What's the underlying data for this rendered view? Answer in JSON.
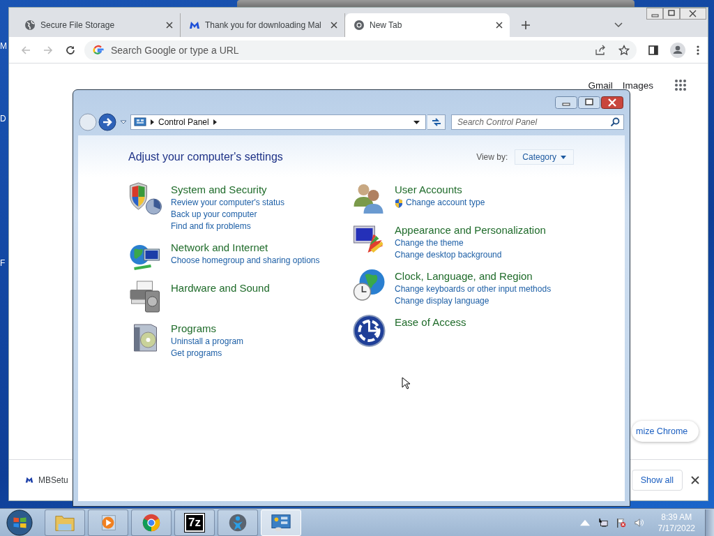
{
  "desktop": {
    "labels": [
      "M",
      "D",
      "F"
    ]
  },
  "browser": {
    "tabs": [
      {
        "title": "Secure File Storage",
        "kind": "globe",
        "selected": false
      },
      {
        "title": "Thank you for downloading Mal",
        "kind": "logo",
        "selected": false
      },
      {
        "title": "New Tab",
        "kind": "chrome",
        "selected": true
      }
    ],
    "omnibox": {
      "placeholder": "Search Google or type a URL"
    },
    "links": [
      "Gmail",
      "Images"
    ],
    "customize_button": "mize Chrome",
    "download": {
      "file": "MBSetu",
      "show_all": "Show all"
    }
  },
  "control_panel": {
    "breadcrumb": "Control Panel",
    "search": {
      "placeholder": "Search Control Panel"
    },
    "heading": "Adjust your computer's settings",
    "view_by": {
      "label": "View by:",
      "value": "Category"
    },
    "columns": [
      [
        {
          "kind": "security",
          "title": "System and Security",
          "links": [
            {
              "text": "Review your computer's status",
              "shield": false
            },
            {
              "text": "Back up your computer",
              "shield": false
            },
            {
              "text": "Find and fix problems",
              "shield": false
            }
          ]
        },
        {
          "kind": "network",
          "title": "Network and Internet",
          "links": [
            {
              "text": "Choose homegroup and sharing options",
              "shield": false
            }
          ]
        },
        {
          "kind": "hardware",
          "title": "Hardware and Sound"
        },
        {
          "kind": "programs",
          "title": "Programs",
          "links": [
            {
              "text": "Uninstall a program",
              "shield": false
            },
            {
              "text": "Get programs",
              "shield": false
            }
          ]
        }
      ],
      [
        {
          "kind": "users",
          "title": "User Accounts",
          "links": [
            {
              "text": "Change account type",
              "shield": true
            }
          ]
        },
        {
          "kind": "appearance",
          "title": "Appearance and Personalization",
          "links": [
            {
              "text": "Change the theme",
              "shield": false
            },
            {
              "text": "Change desktop background",
              "shield": false
            }
          ]
        },
        {
          "kind": "clock",
          "title": "Clock, Language, and Region",
          "links": [
            {
              "text": "Change keyboards or other input methods",
              "shield": false
            },
            {
              "text": "Change display language",
              "shield": false
            }
          ]
        },
        {
          "kind": "access",
          "title": "Ease of Access"
        }
      ]
    ]
  },
  "taskbar": {
    "apps": [
      {
        "kind": "explorer",
        "selected": false
      },
      {
        "kind": "media",
        "selected": false
      },
      {
        "kind": "chrome",
        "selected": false
      },
      {
        "kind": "sevenzip",
        "label": "7z",
        "selected": false
      },
      {
        "kind": "figure",
        "selected": false
      },
      {
        "kind": "control",
        "selected": true
      }
    ],
    "clock": {
      "time": "8:39 AM",
      "date": "7/17/2022"
    }
  }
}
